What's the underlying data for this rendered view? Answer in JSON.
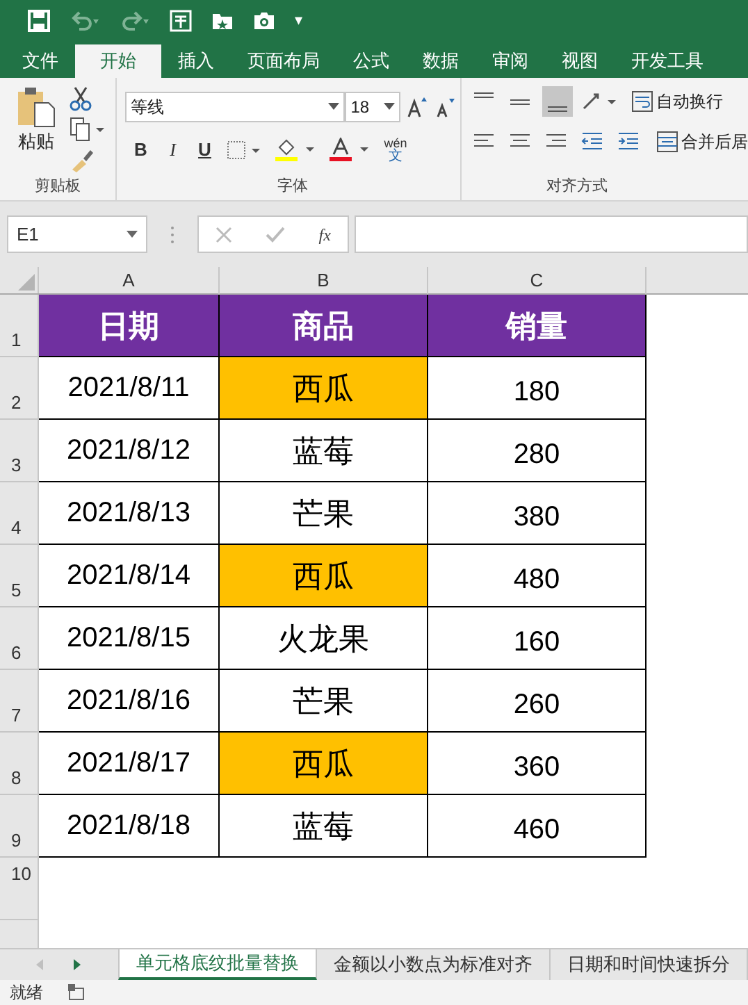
{
  "quick_access": {
    "more": "▾"
  },
  "ribbon_tabs": [
    {
      "label": "文件",
      "selected": false
    },
    {
      "label": "开始",
      "selected": true
    },
    {
      "label": "插入",
      "selected": false
    },
    {
      "label": "页面布局",
      "selected": false
    },
    {
      "label": "公式",
      "selected": false
    },
    {
      "label": "数据",
      "selected": false
    },
    {
      "label": "审阅",
      "selected": false
    },
    {
      "label": "视图",
      "selected": false
    },
    {
      "label": "开发工具",
      "selected": false
    }
  ],
  "clipboard": {
    "paste": "粘贴",
    "label": "剪贴板"
  },
  "font": {
    "name": "等线",
    "size": "18",
    "bold": "B",
    "italic": "I",
    "underline": "U",
    "phonetic_top": "wén",
    "phonetic_bottom": "文",
    "label": "字体"
  },
  "alignment": {
    "wrap": "自动换行",
    "merge": "合并后居",
    "label": "对齐方式"
  },
  "formula_bar": {
    "name_box": "E1",
    "fx": "fx"
  },
  "columns": [
    "A",
    "B",
    "C"
  ],
  "header": [
    "日期",
    "商品",
    "销量"
  ],
  "rows": [
    {
      "num": "2",
      "date": "2021/8/11",
      "product": "西瓜",
      "highlighted": true,
      "sales": "180"
    },
    {
      "num": "3",
      "date": "2021/8/12",
      "product": "蓝莓",
      "highlighted": false,
      "sales": "280"
    },
    {
      "num": "4",
      "date": "2021/8/13",
      "product": "芒果",
      "highlighted": false,
      "sales": "380"
    },
    {
      "num": "5",
      "date": "2021/8/14",
      "product": "西瓜",
      "highlighted": true,
      "sales": "480"
    },
    {
      "num": "6",
      "date": "2021/8/15",
      "product": "火龙果",
      "highlighted": false,
      "sales": "160"
    },
    {
      "num": "7",
      "date": "2021/8/16",
      "product": "芒果",
      "highlighted": false,
      "sales": "260"
    },
    {
      "num": "8",
      "date": "2021/8/17",
      "product": "西瓜",
      "highlighted": true,
      "sales": "360"
    },
    {
      "num": "9",
      "date": "2021/8/18",
      "product": "蓝莓",
      "highlighted": false,
      "sales": "460"
    }
  ],
  "header_row_num": "1",
  "empty_row_num": "10",
  "sheet_tabs": [
    {
      "label": "单元格底纹批量替换",
      "selected": true
    },
    {
      "label": "金额以小数点为标准对齐",
      "selected": false
    },
    {
      "label": "日期和时间快速拆分",
      "selected": false
    }
  ],
  "status": "就绪"
}
